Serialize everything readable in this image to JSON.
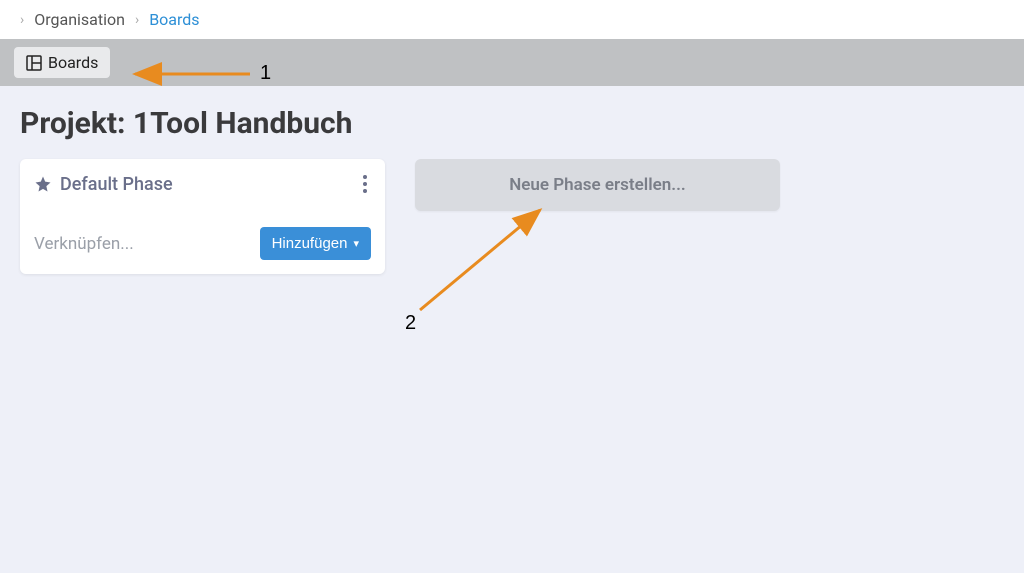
{
  "breadcrumb": {
    "level1": "Organisation",
    "level2": "Boards"
  },
  "tabs": {
    "boards": "Boards"
  },
  "page": {
    "title": "Projekt: 1Tool Handbuch"
  },
  "phase": {
    "name": "Default Phase",
    "link_placeholder": "Verknüpfen...",
    "add_label": "Hinzufügen"
  },
  "new_phase": {
    "label": "Neue Phase erstellen..."
  },
  "annotations": {
    "n1": "1",
    "n2": "2"
  }
}
